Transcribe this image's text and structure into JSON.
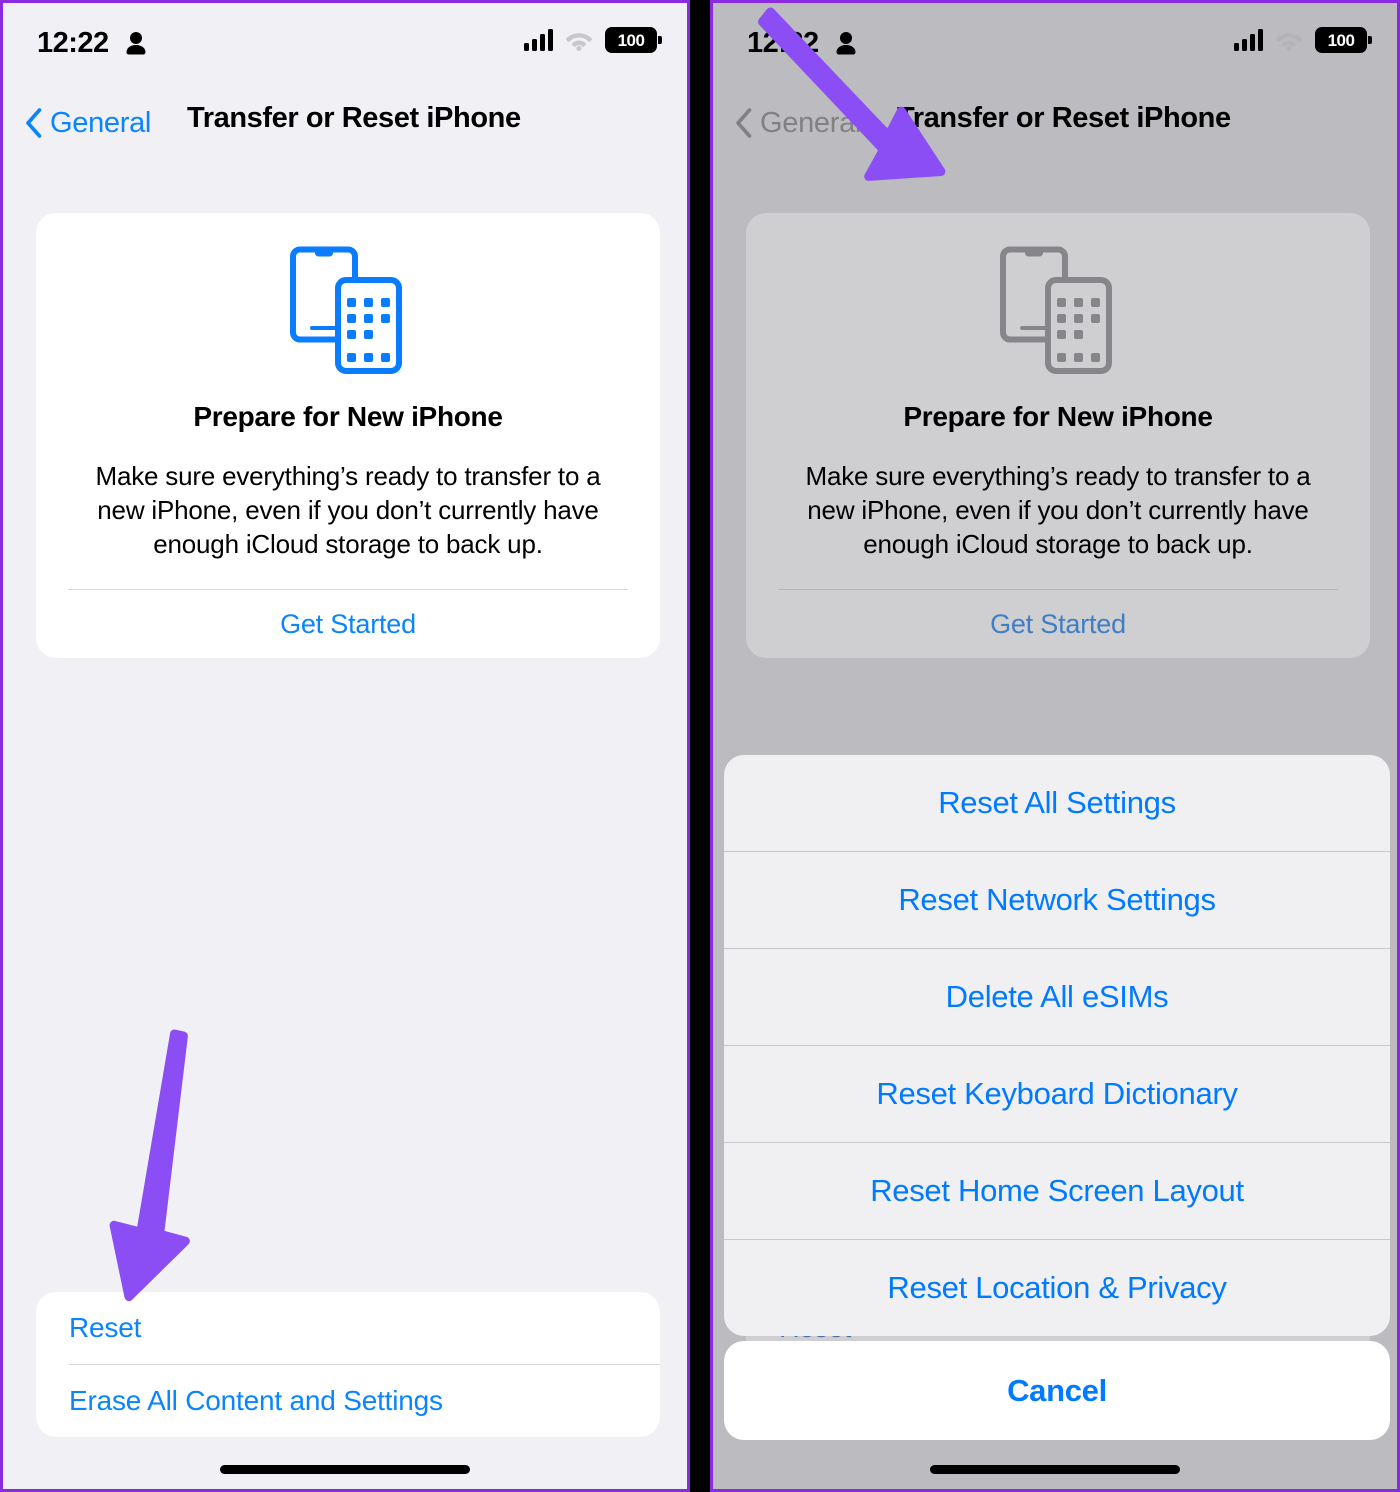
{
  "status_bar": {
    "time": "12:22",
    "battery_level": "100",
    "person_icon": "person-icon",
    "signal_icon": "cellular-signal-icon",
    "wifi_icon": "wifi-icon",
    "battery_icon": "battery-icon"
  },
  "nav": {
    "back_label": "General",
    "title": "Transfer or Reset iPhone",
    "back_icon": "chevron-left-icon"
  },
  "prepare_card": {
    "icon": "two-iphones-icon",
    "title": "Prepare for New iPhone",
    "description": "Make sure everything’s ready to transfer to a new iPhone, even if you don’t currently have enough iCloud storage to back up.",
    "action_label": "Get Started"
  },
  "reset_group": {
    "rows": [
      {
        "label": "Reset"
      },
      {
        "label": "Erase All Content and Settings"
      }
    ]
  },
  "action_sheet": {
    "items": [
      {
        "label": "Reset All Settings"
      },
      {
        "label": "Reset Network Settings"
      },
      {
        "label": "Delete All eSIMs"
      },
      {
        "label": "Reset Keyboard Dictionary"
      },
      {
        "label": "Reset Home Screen Layout"
      },
      {
        "label": "Reset Location & Privacy"
      }
    ],
    "cancel_label": "Cancel"
  },
  "annotations": {
    "left_arrow": "down-arrow-annotation",
    "right_arrow": "diagonal-arrow-annotation",
    "arrow_color": "#8b4ef5"
  },
  "colors": {
    "accent_blue": "#007aff",
    "link_blue": "#0a84ff",
    "panel_background": "#f1f0f5",
    "dimmed_panel_background": "#bcbcc0",
    "card_white": "#ffffff",
    "sheet_background": "#f0f0f2",
    "border_purple": "#8a2be2"
  }
}
